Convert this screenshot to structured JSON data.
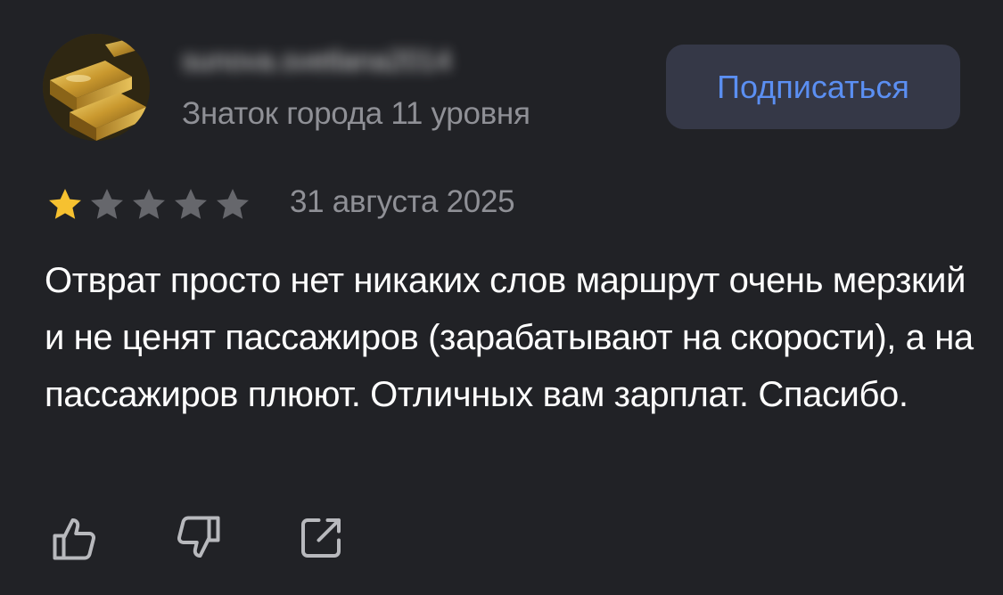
{
  "review": {
    "author_name": "sunova.svetlana2014",
    "author_level": "Знаток города 11 уровня",
    "subscribe_label": "Подписаться",
    "rating": 1,
    "rating_max": 5,
    "date": "31 августа 2025",
    "text": "Отврат просто нет никаких слов маршрут очень мерзкий и не ценят пассажиров (зарабатывают на скорости), а на пассажиров плюют. Отличных вам зарплат. Спасибо."
  },
  "actions": {
    "like_icon": "thumbs-up-icon",
    "dislike_icon": "thumbs-down-icon",
    "share_icon": "share-icon"
  },
  "colors": {
    "background": "#212226",
    "accent": "#5b8ff2",
    "star_active": "#f6c130",
    "star_inactive": "#66676c",
    "muted_text": "#8f9096",
    "button_bg": "#353847"
  }
}
